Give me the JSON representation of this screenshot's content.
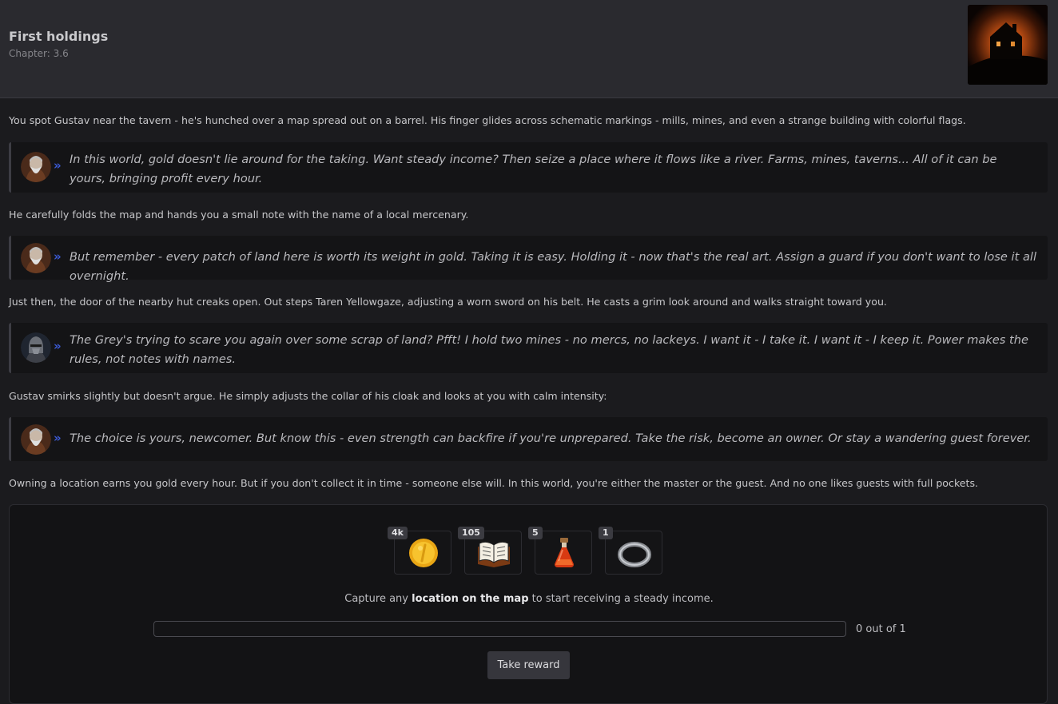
{
  "header": {
    "title": "First holdings",
    "chapter": "Chapter: 3.6"
  },
  "story": {
    "narration_1": "You spot Gustav near the tavern - he's hunched over a map spread out on a barrel. His finger glides across schematic markings - mills, mines, and even a strange building with colorful flags.",
    "quote_1": "In this world, gold doesn't lie around for the taking. Want steady income? Then seize a place where it flows like a river. Farms, mines, taverns... All of it can be yours, bringing profit every hour.",
    "narration_2": "He carefully folds the map and hands you a small note with the name of a local mercenary.",
    "quote_2": "But remember - every patch of land here is worth its weight in gold. Taking it is easy. Holding it - now that's the real art. Assign a guard if you don't want to lose it all overnight.",
    "narration_3": "Just then, the door of the nearby hut creaks open. Out steps Taren Yellowgaze, adjusting a worn sword on his belt. He casts a grim look around and walks straight toward you.",
    "quote_3": "The Grey's trying to scare you again over some scrap of land? Pfft! I hold two mines - no mercs, no lackeys. I want it - I take it. I want it - I keep it. Power makes the rules, not notes with names.",
    "narration_4": "Gustav smirks slightly but doesn't argue. He simply adjusts the collar of his cloak and looks at you with calm intensity:",
    "quote_4": "The choice is yours, newcomer. But know this - even strength can backfire if you're unprepared. Take the risk, become an owner. Or stay a wandering guest forever.",
    "narration_5": "Owning a location earns you gold every hour. But if you don't collect it in time - someone else will. In this world, you're either the master or the guest. And no one likes guests with full pockets.",
    "chevron": "»"
  },
  "quest": {
    "rewards": [
      {
        "count": "4k",
        "icon": "gold-coin-icon"
      },
      {
        "count": "105",
        "icon": "book-icon"
      },
      {
        "count": "5",
        "icon": "potion-icon"
      },
      {
        "count": "1",
        "icon": "ring-icon"
      }
    ],
    "task_prefix": "Capture any ",
    "task_bold": "location on the map",
    "task_suffix": " to start receiving a steady income.",
    "progress_value": 0,
    "progress_max": 1,
    "progress_text": "0 out of 1",
    "button_label": "Take reward",
    "accent_color": "#3c5bd8"
  }
}
